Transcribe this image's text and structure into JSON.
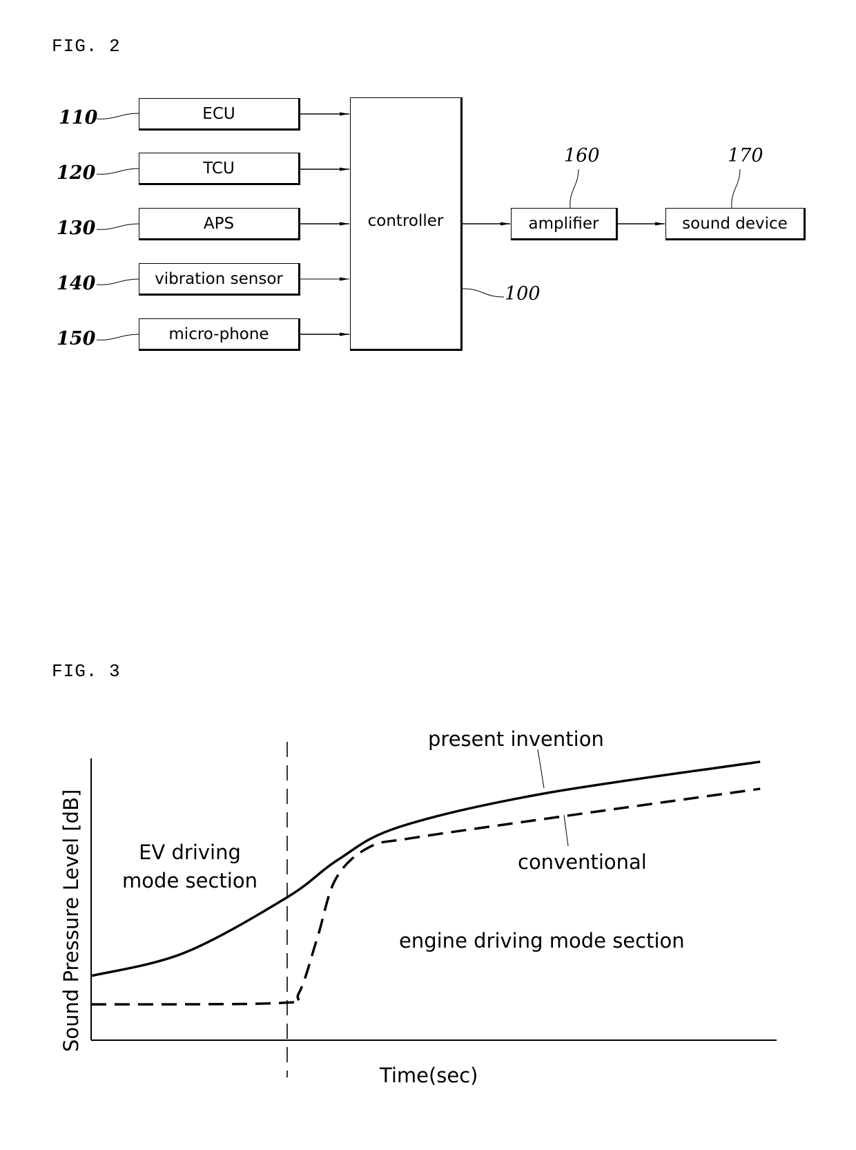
{
  "fig2": {
    "title": "FIG. 2",
    "inputs": [
      {
        "ref": "110",
        "label": "ECU"
      },
      {
        "ref": "120",
        "label": "TCU"
      },
      {
        "ref": "130",
        "label": "APS"
      },
      {
        "ref": "140",
        "label": "vibration sensor"
      },
      {
        "ref": "150",
        "label": "micro-phone"
      }
    ],
    "controller": {
      "ref": "100",
      "label": "controller"
    },
    "amplifier": {
      "ref": "160",
      "label": "amplifier"
    },
    "sound_device": {
      "ref": "170",
      "label": "sound device"
    }
  },
  "fig3": {
    "title": "FIG. 3",
    "annotations": {
      "ev_section": "EV driving\nmode section",
      "engine_section": "engine driving mode section",
      "present_invention": "present invention",
      "conventional": "conventional"
    }
  },
  "chart_data": {
    "type": "line",
    "title": "FIG. 3",
    "xlabel": "Time(sec)",
    "ylabel": "Sound Pressure Level [dB]",
    "xlim": [
      0,
      100
    ],
    "ylim": [
      0,
      100
    ],
    "units_note": "relative (no tick values shown)",
    "grid": false,
    "mode_boundary_x": 28.6,
    "series": [
      {
        "name": "present invention",
        "style": "solid",
        "x": [
          0,
          13.6,
          28.6,
          36,
          45,
          66,
          97.6
        ],
        "y": [
          22.8,
          31,
          50.7,
          64,
          75.7,
          87.5,
          98.8
        ]
      },
      {
        "name": "conventional",
        "style": "dashed",
        "x": [
          0,
          27.6,
          30.3,
          33,
          35.7,
          40.5,
          47,
          69.6,
          97.6
        ],
        "y": [
          12.7,
          13.2,
          16.7,
          36.3,
          57.3,
          68.4,
          71.8,
          79.7,
          89.2
        ]
      }
    ]
  }
}
